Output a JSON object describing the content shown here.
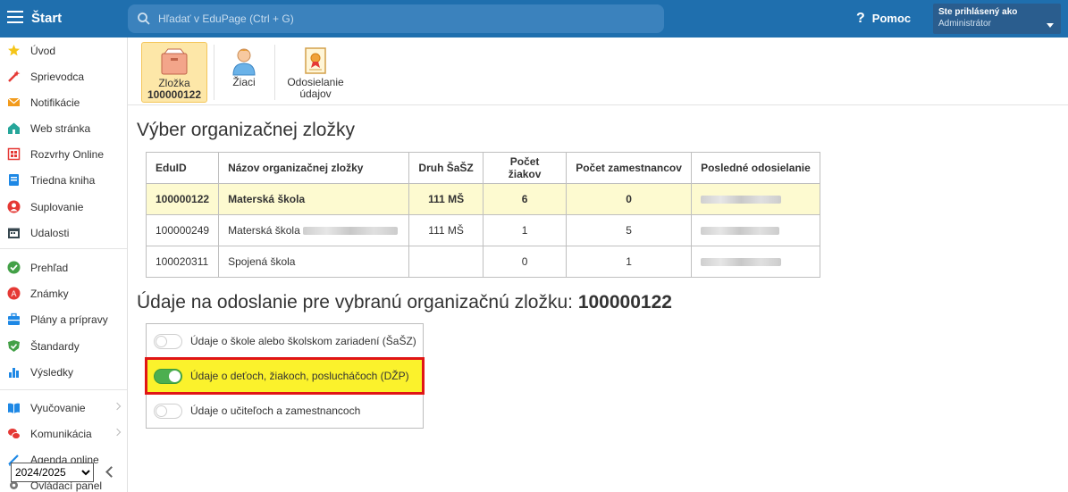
{
  "topbar": {
    "title": "Štart",
    "search_placeholder": "Hľadať v EduPage (Ctrl + G)",
    "help": "Pomoc",
    "user_line1": "Ste prihlásený ako",
    "user_line2": "Administrátor"
  },
  "sidebar": {
    "items": [
      {
        "label": "Úvod",
        "icon": "star-icon",
        "color": "#f5c518"
      },
      {
        "label": "Sprievodca",
        "icon": "magic-wand-icon",
        "color": "#e53935"
      },
      {
        "label": "Notifikácie",
        "icon": "envelope-icon",
        "color": "#f29b1d"
      },
      {
        "label": "Web stránka",
        "icon": "house-icon",
        "color": "#26a69a"
      },
      {
        "label": "Rozvrhy Online",
        "icon": "timetable-icon",
        "color": "#e53935"
      },
      {
        "label": "Triedna kniha",
        "icon": "book-icon",
        "color": "#1e88e5"
      },
      {
        "label": "Suplovanie",
        "icon": "person-icon",
        "color": "#e53935"
      },
      {
        "label": "Udalosti",
        "icon": "calendar-icon",
        "color": "#37474f"
      },
      {
        "label": "Prehľad",
        "icon": "check-circle-icon",
        "color": "#43a047"
      },
      {
        "label": "Známky",
        "icon": "grades-icon",
        "color": "#e53935"
      },
      {
        "label": "Plány a prípravy",
        "icon": "briefcase-icon",
        "color": "#1e88e5"
      },
      {
        "label": "Štandardy",
        "icon": "shield-check-icon",
        "color": "#43a047"
      },
      {
        "label": "Výsledky",
        "icon": "bar-chart-icon",
        "color": "#1e88e5"
      },
      {
        "label": "Vyučovanie",
        "icon": "open-book-icon",
        "color": "#1e88e5"
      },
      {
        "label": "Komunikácia",
        "icon": "chat-icon",
        "color": "#e53935"
      },
      {
        "label": "Agenda online",
        "icon": "pen-icon",
        "color": "#1e88e5"
      },
      {
        "label": "Ovládací panel",
        "icon": "gear-icon",
        "color": "#777777"
      }
    ],
    "year_options": [
      "2024/2025"
    ]
  },
  "toolbar": {
    "folder_l1": "Zložka",
    "folder_l2": "100000122",
    "students": "Žiaci",
    "send_l1": "Odosielanie",
    "send_l2": "údajov"
  },
  "main": {
    "title": "Výber organizačnej zložky",
    "table": {
      "headers": [
        "EduID",
        "Názov organizačnej zložky",
        "Druh ŠaŠZ",
        "Počet žiakov",
        "Počet zamestnancov",
        "Posledné odosielanie"
      ],
      "rows": [
        {
          "eduid": "100000122",
          "name": "Materská škola",
          "kind": "111 MŠ",
          "students": "6",
          "staff": "0"
        },
        {
          "eduid": "100000249",
          "name": "Materská škola",
          "kind": "111 MŠ",
          "students": "1",
          "staff": "5"
        },
        {
          "eduid": "100020311",
          "name": "Spojená škola",
          "kind": "",
          "students": "0",
          "staff": "1"
        }
      ]
    },
    "send_title": "Údaje na odoslanie pre vybranú organizačnú zložku:",
    "send_id": "100000122",
    "toggles": [
      {
        "label": "Údaje o škole alebo školskom zariadení (ŠaŠZ)",
        "on": false
      },
      {
        "label": "Údaje o deťoch, žiakoch, poslucháčoch (DŽP)",
        "on": true
      },
      {
        "label": "Údaje o učiteľoch a zamestnancoch",
        "on": false
      }
    ]
  }
}
